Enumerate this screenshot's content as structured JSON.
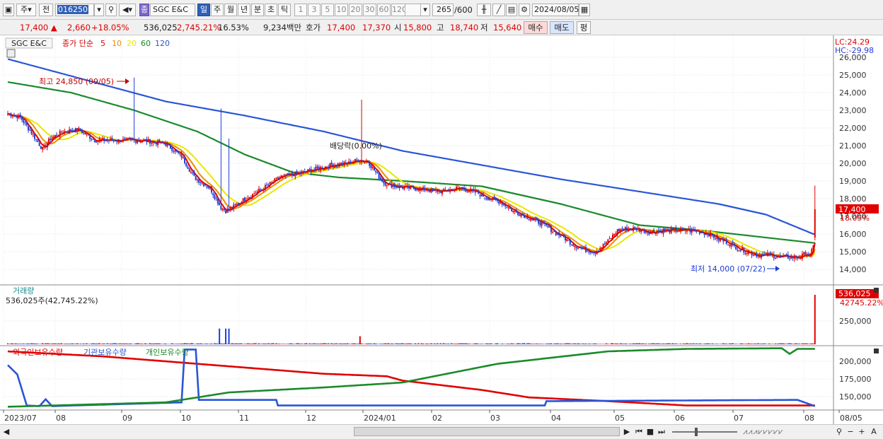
{
  "toolbar": {
    "period_options": "주",
    "prev_label": "전",
    "stock_code": "016250",
    "stock_badge": "종",
    "stock_name": "SGC E&C",
    "tabs": [
      "일",
      "주",
      "월",
      "년",
      "분",
      "초",
      "틱"
    ],
    "num_tabs": [
      "1",
      "3",
      "5",
      "10",
      "20",
      "30",
      "60",
      "120"
    ],
    "count_value": "265",
    "count_total": "/600",
    "date": "2024/08/05"
  },
  "quote": {
    "price": "17,400",
    "change": "2,660",
    "change_pct": "+18.05%",
    "volume": "536,025",
    "volume_ratio": "2,745.21%",
    "turnover": "16.53%",
    "amount": "9,234백만",
    "bid_label": "호가",
    "bid1": "17,400",
    "bid2": "17,370",
    "open_label": "시",
    "open": "15,800",
    "high_label": "고",
    "high": "18,740",
    "low_label": "저",
    "low": "15,640",
    "buy_label": "매수",
    "sell_label": "매도",
    "avg_label": "평"
  },
  "legend": {
    "stock": "SGC E&C",
    "ma_label": "종가 단순",
    "ma_periods": [
      "5",
      "10",
      "20",
      "60",
      "120"
    ],
    "ma_colors": [
      "#e00000",
      "#f08c00",
      "#e8e800",
      "#1a8a2a",
      "#2a55d6"
    ]
  },
  "chart_data": [
    {
      "type": "candlestick",
      "title": "SGC E&C",
      "y_ticks": [
        "26,000",
        "25,000",
        "24,000",
        "23,000",
        "22,000",
        "21,000",
        "20,000",
        "19,000",
        "18,000",
        "17,000",
        "16,000",
        "15,000",
        "14,000"
      ],
      "ylim": [
        13500,
        26200
      ],
      "lc_label": "LC:24.29",
      "hc_label": "HC:-29.98",
      "last_price_label": "17,400",
      "last_pct_label": "18.05%",
      "annotations": {
        "high": "최고 24,850 (09/05)",
        "low": "최저 14,000 (07/22)",
        "event": "배당락(0.00%)"
      },
      "close_anchors": [
        [
          0,
          22800
        ],
        [
          8,
          22600
        ],
        [
          16,
          21600
        ],
        [
          22,
          20800
        ],
        [
          27,
          21400
        ],
        [
          35,
          21800
        ],
        [
          45,
          21900
        ],
        [
          55,
          21300
        ],
        [
          70,
          21300
        ],
        [
          85,
          21300
        ],
        [
          100,
          21100
        ],
        [
          110,
          20400
        ],
        [
          118,
          19200
        ],
        [
          128,
          18600
        ],
        [
          135,
          17500
        ],
        [
          138,
          17300
        ],
        [
          144,
          17600
        ],
        [
          152,
          18100
        ],
        [
          162,
          18600
        ],
        [
          172,
          19200
        ],
        [
          182,
          19400
        ],
        [
          192,
          19600
        ],
        [
          205,
          19900
        ],
        [
          215,
          20000
        ],
        [
          222,
          20200
        ],
        [
          228,
          20100
        ],
        [
          232,
          19600
        ],
        [
          238,
          18900
        ],
        [
          245,
          18700
        ],
        [
          255,
          18600
        ],
        [
          265,
          18500
        ],
        [
          275,
          18400
        ],
        [
          285,
          18600
        ],
        [
          295,
          18400
        ],
        [
          305,
          18000
        ],
        [
          312,
          17800
        ],
        [
          320,
          17300
        ],
        [
          328,
          17000
        ],
        [
          338,
          16600
        ],
        [
          346,
          16100
        ],
        [
          352,
          15800
        ],
        [
          358,
          15400
        ],
        [
          365,
          15100
        ],
        [
          372,
          15000
        ],
        [
          380,
          15600
        ],
        [
          386,
          16200
        ],
        [
          392,
          16300
        ],
        [
          398,
          16300
        ],
        [
          406,
          16100
        ],
        [
          414,
          16200
        ],
        [
          424,
          16200
        ],
        [
          434,
          16200
        ],
        [
          444,
          16000
        ],
        [
          450,
          15700
        ],
        [
          456,
          15500
        ],
        [
          462,
          15200
        ],
        [
          468,
          15000
        ],
        [
          475,
          14800
        ],
        [
          482,
          14800
        ],
        [
          490,
          14700
        ],
        [
          497,
          14700
        ],
        [
          502,
          14700
        ],
        [
          505,
          14900
        ],
        [
          508,
          14750
        ],
        [
          510,
          15300
        ]
      ],
      "spikes": [
        [
          80,
          24850
        ],
        [
          135,
          23100
        ],
        [
          140,
          21400
        ],
        [
          224,
          23600
        ],
        [
          511,
          18740
        ]
      ],
      "ma_anchors": {
        "ma120": [
          [
            0,
            25900
          ],
          [
            50,
            24700
          ],
          [
            100,
            23500
          ],
          [
            150,
            22700
          ],
          [
            200,
            21800
          ],
          [
            250,
            20700
          ],
          [
            300,
            19900
          ],
          [
            350,
            19100
          ],
          [
            400,
            18400
          ],
          [
            450,
            17700
          ],
          [
            480,
            17100
          ],
          [
            510,
            16000
          ]
        ],
        "ma60": [
          [
            0,
            24600
          ],
          [
            40,
            24000
          ],
          [
            80,
            23000
          ],
          [
            120,
            21800
          ],
          [
            150,
            20500
          ],
          [
            180,
            19500
          ],
          [
            210,
            19200
          ],
          [
            250,
            19000
          ],
          [
            300,
            18700
          ],
          [
            350,
            17700
          ],
          [
            400,
            16500
          ],
          [
            440,
            16200
          ],
          [
            480,
            15800
          ],
          [
            510,
            15500
          ]
        ]
      },
      "volume": {
        "label": "거래량",
        "value_label": "536,025주(42,745.22%)",
        "tick": "250,000",
        "last_label": "536,025",
        "last_pct": "42745.22%",
        "spikes": [
          [
            134,
            170000
          ],
          [
            138,
            170000
          ],
          [
            140,
            170000
          ],
          [
            223,
            88000
          ],
          [
            511,
            536025
          ]
        ]
      }
    },
    {
      "type": "line",
      "series": [
        {
          "name": "외국인보유수량",
          "color": "#e00000"
        },
        {
          "name": "기관보유수량",
          "color": "#2a55d6"
        },
        {
          "name": "개인보유수량",
          "color": "#1a8a2a"
        }
      ],
      "y_ticks": [
        "200,000",
        "175,000",
        "150,000"
      ]
    }
  ],
  "x_axis": [
    "2023/07",
    "08",
    "09",
    "10",
    "11",
    "12",
    "2024/01",
    "02",
    "03",
    "04",
    "05",
    "06",
    "07",
    "08",
    "08/05"
  ]
}
